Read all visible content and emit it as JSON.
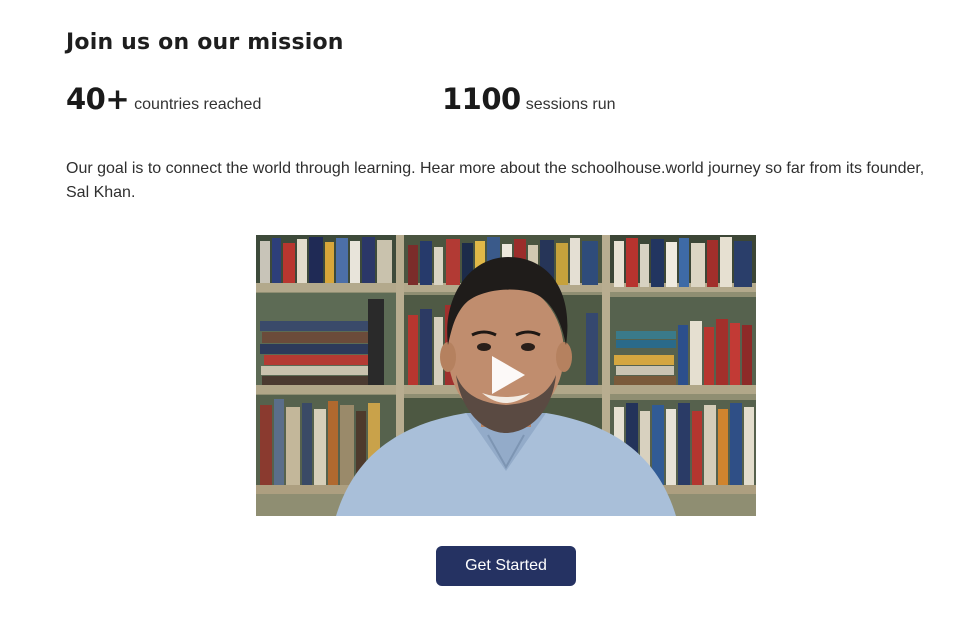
{
  "heading": "Join us on our mission",
  "stats": [
    {
      "value": "40+",
      "label": "countries reached"
    },
    {
      "value": "1100",
      "label": "sessions run"
    }
  ],
  "description": "Our goal is to connect the world through learning. Hear more about the schoolhouse.world journey so far from its founder, Sal Khan.",
  "video": {
    "play_icon": "play-icon"
  },
  "cta": {
    "label": "Get Started",
    "color": "#253262"
  }
}
